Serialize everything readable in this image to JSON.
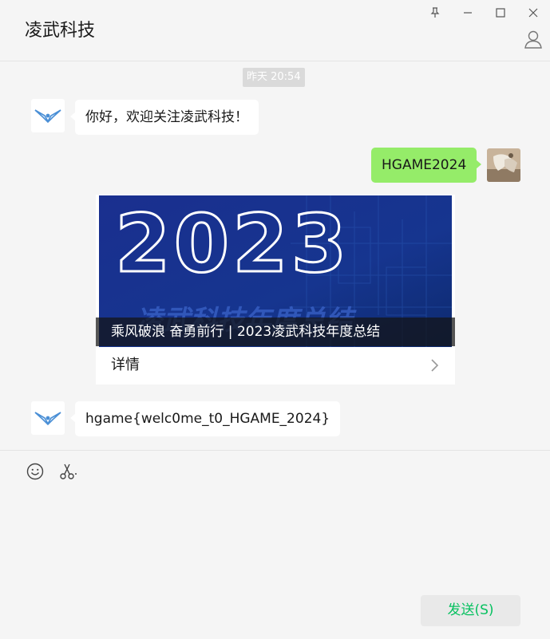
{
  "window": {
    "title": "凌武科技",
    "controls": [
      "pin-icon",
      "minimize-icon",
      "maximize-icon",
      "close-icon"
    ],
    "profile_icon": "person-icon"
  },
  "chat": {
    "timestamp": "昨天 20:54",
    "messages": [
      {
        "side": "left",
        "sender": "凌武科技",
        "text": "你好，欢迎关注凌武科技！"
      },
      {
        "side": "right",
        "sender": "me",
        "text": "HGAME2024"
      },
      {
        "side": "left",
        "type": "article",
        "image_text": "2023",
        "image_subtext": "凌武科技年度总结",
        "caption": "乘风破浪 奋勇前行 | 2023凌武科技年度总结",
        "detail_label": "详情"
      },
      {
        "side": "left",
        "sender": "凌武科技",
        "text": "hgame{welc0me_t0_HGAME_2024}"
      }
    ]
  },
  "toolbar": {
    "icons": [
      "emoji-icon",
      "scissors-icon"
    ]
  },
  "send_button": {
    "label": "发送(S)"
  },
  "colors": {
    "background": "#f5f5f5",
    "bubble_self": "#95ec69",
    "bubble_other": "#ffffff",
    "send_text": "#07c160",
    "article_image_bg": "#13308a"
  }
}
